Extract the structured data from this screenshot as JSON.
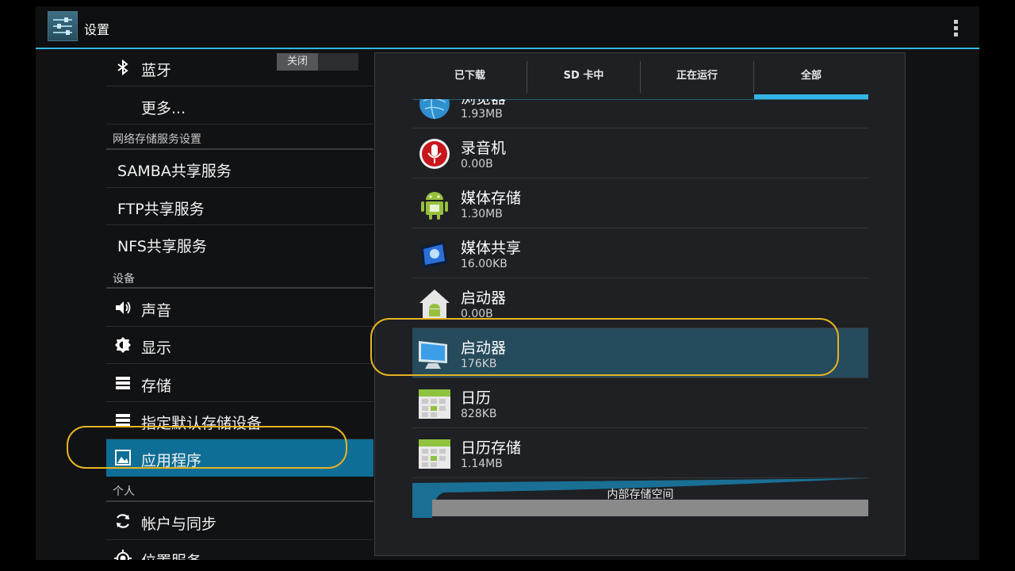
{
  "actionbar": {
    "title": "设置"
  },
  "left_menu": {
    "bluetooth": {
      "label": "蓝牙",
      "toggle": "关闭"
    },
    "more": {
      "label": "更多..."
    },
    "section_network": "网络存储服务设置",
    "samba": "SAMBA共享服务",
    "ftp": "FTP共享服务",
    "nfs": "NFS共享服务",
    "section_device": "设备",
    "sound": "声音",
    "display": "显示",
    "storage": "存储",
    "default_storage": "指定默认存储设备",
    "apps": "应用程序",
    "section_personal": "个人",
    "accounts": "帐户与同步",
    "location": "位置服务"
  },
  "tabs": [
    {
      "label": "已下载"
    },
    {
      "label": "SD 卡中"
    },
    {
      "label": "正在运行"
    },
    {
      "label": "全部"
    }
  ],
  "active_tab": "全部",
  "apps": [
    {
      "name": "浏览器",
      "size": "1.93MB",
      "icon": "browser-globe-icon"
    },
    {
      "name": "录音机",
      "size": "0.00B",
      "icon": "microphone-icon"
    },
    {
      "name": "媒体存储",
      "size": "1.30MB",
      "icon": "android-robot-icon"
    },
    {
      "name": "媒体共享",
      "size": "16.00KB",
      "icon": "media-share-icon"
    },
    {
      "name": "启动器",
      "size": "0.00B",
      "icon": "android-home-icon"
    },
    {
      "name": "启动器",
      "size": "176KB",
      "icon": "monitor-icon"
    },
    {
      "name": "日历",
      "size": "828KB",
      "icon": "calendar-icon"
    },
    {
      "name": "日历存储",
      "size": "1.14MB",
      "icon": "calendar-icon"
    }
  ],
  "storage": {
    "label": "内部存储空间"
  },
  "colors": {
    "accent": "#33b5e5",
    "highlight": "#e5b321",
    "selected_left": "#0f6e96",
    "selected_right": "#264b5c"
  }
}
